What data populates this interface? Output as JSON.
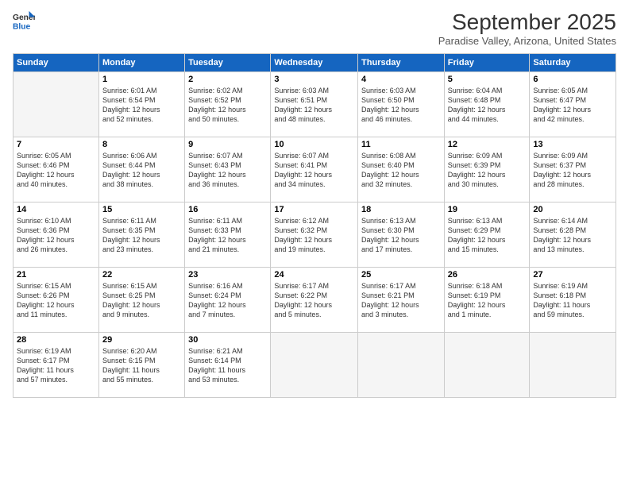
{
  "logo": {
    "line1": "General",
    "line2": "Blue"
  },
  "title": "September 2025",
  "location": "Paradise Valley, Arizona, United States",
  "days_of_week": [
    "Sunday",
    "Monday",
    "Tuesday",
    "Wednesday",
    "Thursday",
    "Friday",
    "Saturday"
  ],
  "weeks": [
    [
      {
        "num": "",
        "info": ""
      },
      {
        "num": "1",
        "info": "Sunrise: 6:01 AM\nSunset: 6:54 PM\nDaylight: 12 hours\nand 52 minutes."
      },
      {
        "num": "2",
        "info": "Sunrise: 6:02 AM\nSunset: 6:52 PM\nDaylight: 12 hours\nand 50 minutes."
      },
      {
        "num": "3",
        "info": "Sunrise: 6:03 AM\nSunset: 6:51 PM\nDaylight: 12 hours\nand 48 minutes."
      },
      {
        "num": "4",
        "info": "Sunrise: 6:03 AM\nSunset: 6:50 PM\nDaylight: 12 hours\nand 46 minutes."
      },
      {
        "num": "5",
        "info": "Sunrise: 6:04 AM\nSunset: 6:48 PM\nDaylight: 12 hours\nand 44 minutes."
      },
      {
        "num": "6",
        "info": "Sunrise: 6:05 AM\nSunset: 6:47 PM\nDaylight: 12 hours\nand 42 minutes."
      }
    ],
    [
      {
        "num": "7",
        "info": "Sunrise: 6:05 AM\nSunset: 6:46 PM\nDaylight: 12 hours\nand 40 minutes."
      },
      {
        "num": "8",
        "info": "Sunrise: 6:06 AM\nSunset: 6:44 PM\nDaylight: 12 hours\nand 38 minutes."
      },
      {
        "num": "9",
        "info": "Sunrise: 6:07 AM\nSunset: 6:43 PM\nDaylight: 12 hours\nand 36 minutes."
      },
      {
        "num": "10",
        "info": "Sunrise: 6:07 AM\nSunset: 6:41 PM\nDaylight: 12 hours\nand 34 minutes."
      },
      {
        "num": "11",
        "info": "Sunrise: 6:08 AM\nSunset: 6:40 PM\nDaylight: 12 hours\nand 32 minutes."
      },
      {
        "num": "12",
        "info": "Sunrise: 6:09 AM\nSunset: 6:39 PM\nDaylight: 12 hours\nand 30 minutes."
      },
      {
        "num": "13",
        "info": "Sunrise: 6:09 AM\nSunset: 6:37 PM\nDaylight: 12 hours\nand 28 minutes."
      }
    ],
    [
      {
        "num": "14",
        "info": "Sunrise: 6:10 AM\nSunset: 6:36 PM\nDaylight: 12 hours\nand 26 minutes."
      },
      {
        "num": "15",
        "info": "Sunrise: 6:11 AM\nSunset: 6:35 PM\nDaylight: 12 hours\nand 23 minutes."
      },
      {
        "num": "16",
        "info": "Sunrise: 6:11 AM\nSunset: 6:33 PM\nDaylight: 12 hours\nand 21 minutes."
      },
      {
        "num": "17",
        "info": "Sunrise: 6:12 AM\nSunset: 6:32 PM\nDaylight: 12 hours\nand 19 minutes."
      },
      {
        "num": "18",
        "info": "Sunrise: 6:13 AM\nSunset: 6:30 PM\nDaylight: 12 hours\nand 17 minutes."
      },
      {
        "num": "19",
        "info": "Sunrise: 6:13 AM\nSunset: 6:29 PM\nDaylight: 12 hours\nand 15 minutes."
      },
      {
        "num": "20",
        "info": "Sunrise: 6:14 AM\nSunset: 6:28 PM\nDaylight: 12 hours\nand 13 minutes."
      }
    ],
    [
      {
        "num": "21",
        "info": "Sunrise: 6:15 AM\nSunset: 6:26 PM\nDaylight: 12 hours\nand 11 minutes."
      },
      {
        "num": "22",
        "info": "Sunrise: 6:15 AM\nSunset: 6:25 PM\nDaylight: 12 hours\nand 9 minutes."
      },
      {
        "num": "23",
        "info": "Sunrise: 6:16 AM\nSunset: 6:24 PM\nDaylight: 12 hours\nand 7 minutes."
      },
      {
        "num": "24",
        "info": "Sunrise: 6:17 AM\nSunset: 6:22 PM\nDaylight: 12 hours\nand 5 minutes."
      },
      {
        "num": "25",
        "info": "Sunrise: 6:17 AM\nSunset: 6:21 PM\nDaylight: 12 hours\nand 3 minutes."
      },
      {
        "num": "26",
        "info": "Sunrise: 6:18 AM\nSunset: 6:19 PM\nDaylight: 12 hours\nand 1 minute."
      },
      {
        "num": "27",
        "info": "Sunrise: 6:19 AM\nSunset: 6:18 PM\nDaylight: 11 hours\nand 59 minutes."
      }
    ],
    [
      {
        "num": "28",
        "info": "Sunrise: 6:19 AM\nSunset: 6:17 PM\nDaylight: 11 hours\nand 57 minutes."
      },
      {
        "num": "29",
        "info": "Sunrise: 6:20 AM\nSunset: 6:15 PM\nDaylight: 11 hours\nand 55 minutes."
      },
      {
        "num": "30",
        "info": "Sunrise: 6:21 AM\nSunset: 6:14 PM\nDaylight: 11 hours\nand 53 minutes."
      },
      {
        "num": "",
        "info": ""
      },
      {
        "num": "",
        "info": ""
      },
      {
        "num": "",
        "info": ""
      },
      {
        "num": "",
        "info": ""
      }
    ]
  ]
}
